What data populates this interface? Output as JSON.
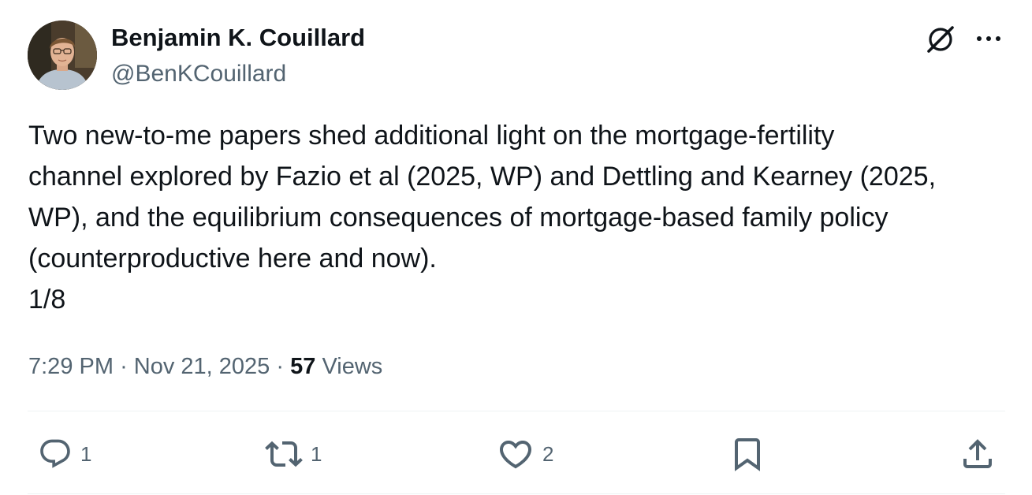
{
  "author": {
    "display_name": "Benjamin K. Couillard",
    "handle": "@BenKCouillard",
    "avatar_icon": "profile-photo"
  },
  "header_actions": {
    "grok_icon": "grok-icon",
    "more_icon": "more-horizontal-icon"
  },
  "tweet": {
    "text_lines": [
      "Two new-to-me papers shed additional light on the mortgage-fertility",
      "channel explored by Fazio et al (2025, WP) and Dettling and Kearney (2025,",
      "WP), and the equilibrium consequences of mortgage-based family policy",
      "(counterproductive here and now).",
      "1/8"
    ],
    "time": "7:29 PM",
    "separator": "·",
    "date": "Nov 21, 2025",
    "views_count": "57",
    "views_label": "Views"
  },
  "actions": {
    "reply": {
      "icon": "reply-icon",
      "count": "1"
    },
    "retweet": {
      "icon": "retweet-icon",
      "count": "1"
    },
    "like": {
      "icon": "heart-icon",
      "count": "2"
    },
    "bookmark": {
      "icon": "bookmark-icon"
    },
    "share": {
      "icon": "share-icon"
    }
  },
  "colors": {
    "text_primary": "#0f1419",
    "text_secondary": "#536471",
    "divider": "#eff3f4"
  }
}
